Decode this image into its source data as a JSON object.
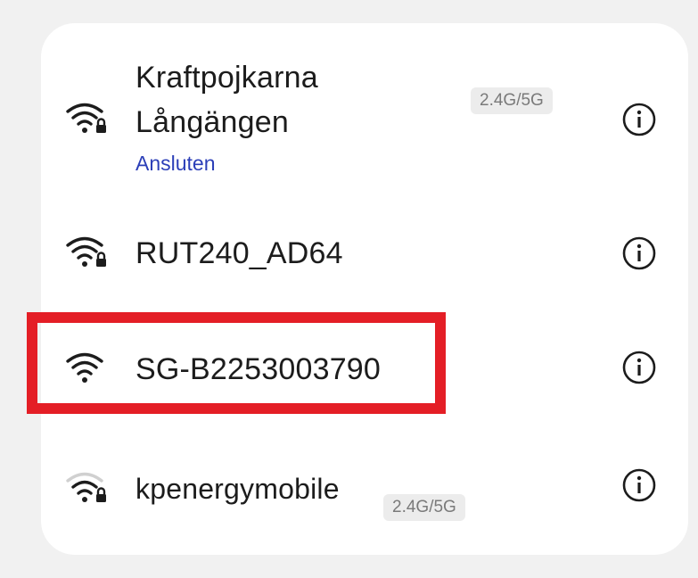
{
  "networks": [
    {
      "ssid_line1": "Kraftpojkarna",
      "ssid_line2": "Långängen",
      "status": "Ansluten",
      "band": "2.4G/5G",
      "icon": "wifi-locked-icon"
    },
    {
      "ssid": "RUT240_AD64",
      "icon": "wifi-locked-icon"
    },
    {
      "ssid": "SG-B2253003790",
      "icon": "wifi-icon"
    },
    {
      "ssid": "kpenergymobile",
      "band": "2.4G/5G",
      "icon": "wifi-weak-locked-icon"
    }
  ],
  "colors": {
    "background": "#f1f1f1",
    "card": "#ffffff",
    "connected_text": "#2c3fb8",
    "highlight_border": "#e41e26",
    "badge_bg": "#ececec",
    "badge_text": "#7a7a7a"
  }
}
